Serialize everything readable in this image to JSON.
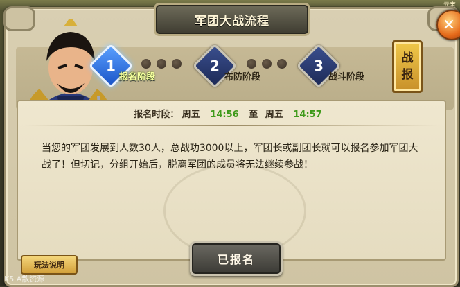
{
  "header": {
    "title": "军团大战流程",
    "top_right_label": "元宝"
  },
  "steps": [
    {
      "number": "1",
      "label": "报名阶段",
      "active": true
    },
    {
      "number": "2",
      "label": "布防阶段",
      "active": false
    },
    {
      "number": "3",
      "label": "战斗阶段",
      "active": false
    }
  ],
  "battle_report": {
    "chars": [
      "战",
      "报"
    ]
  },
  "signup_time": {
    "label": "报名时段：",
    "start_day": "周五",
    "start_time": "14:56",
    "separator": "至",
    "end_day": "周五",
    "end_time": "14:57"
  },
  "description": "当您的军团发展到人数30人，总战功3000以上，军团长或副团长就可以报名参加军团大战了！但切记，分组开始后，脱离军团的成员将无法继续参战！",
  "buttons": {
    "signed": "已报名",
    "rules": "玩法说明"
  },
  "watermark": "K5 A散资源",
  "colors": {
    "active_step": "#3c8cff",
    "time_green": "#3f9a1a",
    "close_orange": "#e56a1a"
  }
}
